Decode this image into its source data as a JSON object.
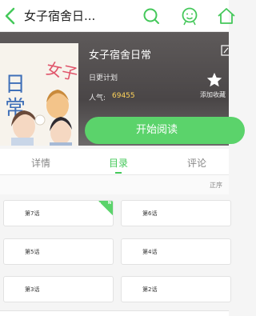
{
  "topbar": {
    "title": "女子宿舍日..."
  },
  "book": {
    "title": "女子宿舍日常",
    "author": "日更计划",
    "popularity_label": "人气:",
    "popularity_value": "69455",
    "favorite_label": "添加收藏",
    "cover_text": "女子宿舍日常",
    "cover_side_text": "日常"
  },
  "read_button": "开始阅读",
  "tabs": [
    {
      "label": "详情",
      "active": false
    },
    {
      "label": "目录",
      "active": true
    },
    {
      "label": "评论",
      "active": false
    }
  ],
  "sort_label": "正序",
  "chapters": [
    {
      "label": "第7话",
      "new": true,
      "new_badge": "N"
    },
    {
      "label": "第6话",
      "new": false
    },
    {
      "label": "第5话",
      "new": false
    },
    {
      "label": "第4话",
      "new": false
    },
    {
      "label": "第3话",
      "new": false
    },
    {
      "label": "第2话",
      "new": false
    }
  ],
  "colors": {
    "accent": "#5bd36b",
    "popularity": "#ffd35a"
  }
}
